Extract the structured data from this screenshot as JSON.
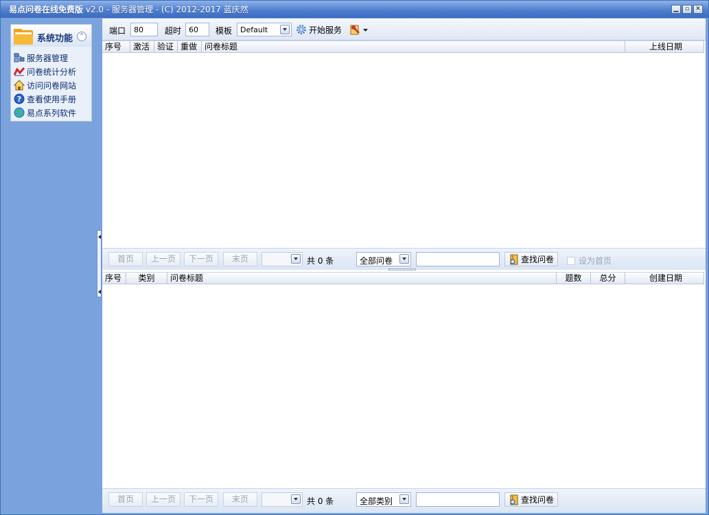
{
  "window": {
    "title_main": "易点问卷在线免费版",
    "title_sub": " v2.0 - 服务器管理 - (C) 2012-2017 蓝庆然",
    "buttons": [
      "▁",
      "▫",
      "✕"
    ]
  },
  "sidebar": {
    "header": "系统功能",
    "items": [
      {
        "label": "服务器管理",
        "icon": "server-manage-icon"
      },
      {
        "label": "问卷统计分析",
        "icon": "stats-chart-icon"
      },
      {
        "label": "访问问卷网站",
        "icon": "home-icon"
      },
      {
        "label": "查看使用手册",
        "icon": "help-icon"
      },
      {
        "label": "易点系列软件",
        "icon": "globe-icon"
      }
    ]
  },
  "toolbar": {
    "port_label": "端口",
    "port_value": "80",
    "timeout_label": "超时",
    "timeout_value": "60",
    "template_label": "模板",
    "template_value": "Default",
    "start_label": "开始服务"
  },
  "online_grid": {
    "columns": [
      "序号",
      "激活",
      "验证",
      "重做",
      "问卷标题",
      "上线日期"
    ]
  },
  "pager_top": {
    "first": "首页",
    "prev": "上一页",
    "next": "下一页",
    "last": "末页",
    "count": "共 0 条",
    "filter": "全部问卷",
    "search_label": "查找问卷",
    "set_home": "设为首页"
  },
  "survey_grid": {
    "columns": [
      "序号",
      "类别",
      "问卷标题",
      "题数",
      "总分",
      "创建日期"
    ]
  },
  "pager_bottom": {
    "first": "首页",
    "prev": "上一页",
    "next": "下一页",
    "last": "末页",
    "count": "共 0 条",
    "filter": "全部类别",
    "search_label": "查找问卷"
  },
  "colors": {
    "sidebar_bg": "#7aa2dc",
    "titlebar": "#3b6bc0"
  }
}
